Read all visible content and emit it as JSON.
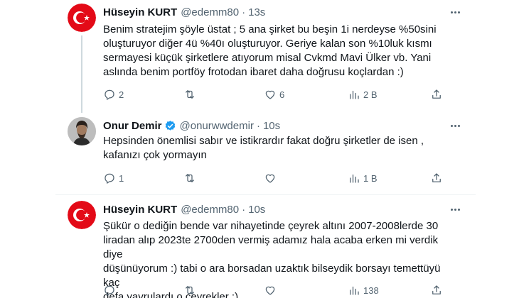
{
  "tweets": [
    {
      "name": "Hüseyin KURT",
      "handle": "@edemm80",
      "time": "13s",
      "verified": false,
      "text": "Benim stratejim şöyle üstat ; 5 ana şirket bu beşin 1i nerdeyse %50sini\noluşturuyor diğer 4ü %40ı oluşturuyor. Geriye kalan son %10luk kısmı\nsermayesi küçük şirketlere atıyorum misal Cvkmd Mavi Ülker vb. Yani\naslında benim portföy frotodan ibaret daha doğrusu koçlardan :)",
      "replies": "2",
      "retweets": "",
      "likes": "6",
      "views": "2 B"
    },
    {
      "name": "Onur Demir",
      "handle": "@onurwwdemir",
      "time": "10s",
      "verified": true,
      "text": "Hepsinden önemlisi sabır ve istikrardır fakat doğru şirketler de isen ,\nkafanızı çok yormayın",
      "replies": "1",
      "retweets": "",
      "likes": "",
      "views": "1 B"
    },
    {
      "name": "Hüseyin KURT",
      "handle": "@edemm80",
      "time": "10s",
      "verified": false,
      "text": "Şükür o dediğin bende var nihayetinde çeyrek altını 2007-2008lerde 30\nliradan alıp 2023te 2700den vermiş adamız hala acaba erken mi verdik diye\ndüşünüyorum :) tabi o ara borsadan uzaktık bilseydik borsayı temettüyü kaç\ndefa yavrulardı o çeyrekler :)",
      "replies": "",
      "retweets": "",
      "likes": "",
      "views": "138"
    }
  ],
  "colors": {
    "text": "#0f1419",
    "muted": "#536471",
    "verified": "#1d9bf0",
    "flag_red": "#e30a17",
    "divider": "#eff3f4"
  },
  "icons": [
    "reply-icon",
    "retweet-icon",
    "like-icon",
    "views-icon",
    "share-icon",
    "more-icon",
    "verified-badge-icon"
  ]
}
